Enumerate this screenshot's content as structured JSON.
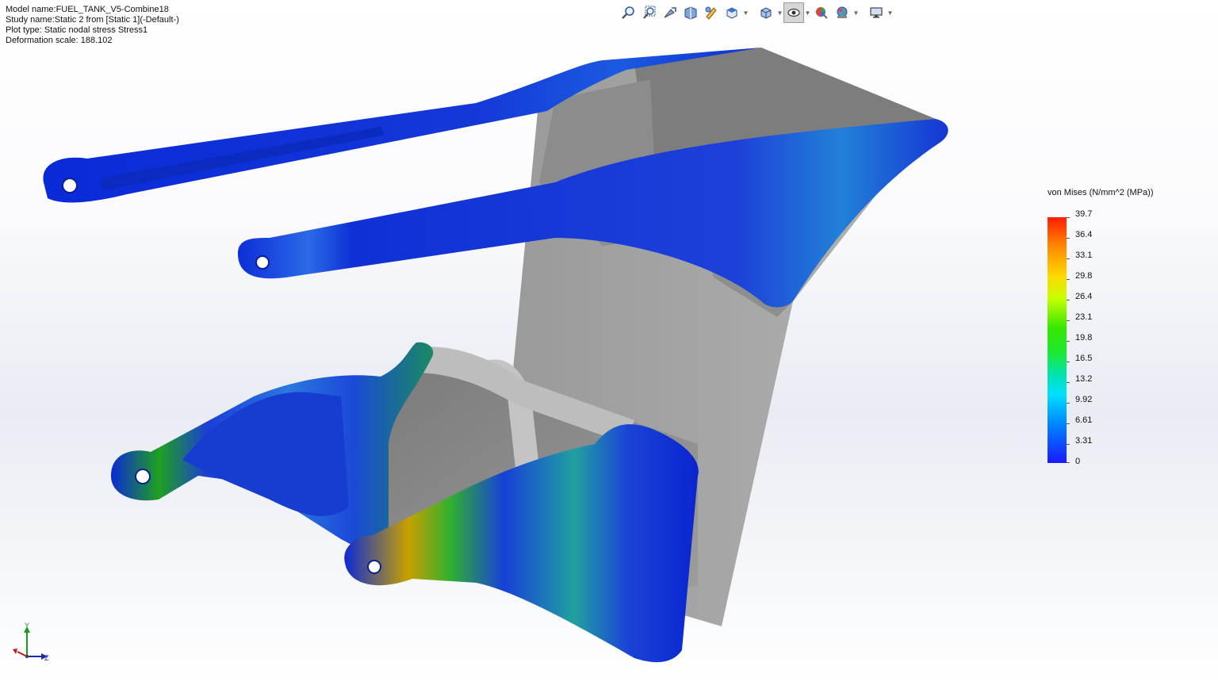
{
  "study_info": {
    "model_name": "Model name:FUEL_TANK_V5-Combine18",
    "study_name": "Study name:Static 2 from [Static 1](-Default-)",
    "plot_type": "Plot type: Static nodal stress Stress1",
    "deformation_scale": "Deformation scale: 188.102"
  },
  "toolbar": {
    "items": [
      {
        "icon": "zoom-to-fit-icon",
        "dropdown": false,
        "active": false
      },
      {
        "icon": "zoom-to-area-icon",
        "dropdown": false,
        "active": false
      },
      {
        "icon": "previous-view-icon",
        "dropdown": false,
        "active": false
      },
      {
        "icon": "section-view-icon",
        "dropdown": false,
        "active": false
      },
      {
        "icon": "dynamic-annotation-icon",
        "dropdown": false,
        "active": false
      },
      {
        "icon": "view-orientation-icon",
        "dropdown": true,
        "active": false
      },
      {
        "icon": "display-style-icon",
        "dropdown": true,
        "active": false
      },
      {
        "icon": "hide-show-items-icon",
        "dropdown": true,
        "active": true
      },
      {
        "icon": "edit-appearance-icon",
        "dropdown": false,
        "active": false
      },
      {
        "icon": "apply-scene-icon",
        "dropdown": true,
        "active": false
      },
      {
        "icon": "view-settings-icon",
        "dropdown": true,
        "active": false
      }
    ]
  },
  "legend": {
    "title": "von Mises (N/mm^2 (MPa))",
    "labels": [
      "39.7",
      "36.4",
      "33.1",
      "29.8",
      "26.4",
      "23.1",
      "19.8",
      "16.5",
      "13.2",
      "9.92",
      "6.61",
      "3.31",
      "0"
    ]
  },
  "triad": {
    "y_label": "Y",
    "z_label": "Z"
  },
  "colors": {
    "stress_low": "#1a1aff",
    "stress_high": "#ff1d00",
    "geometry_gray": "#a3a3a3"
  }
}
